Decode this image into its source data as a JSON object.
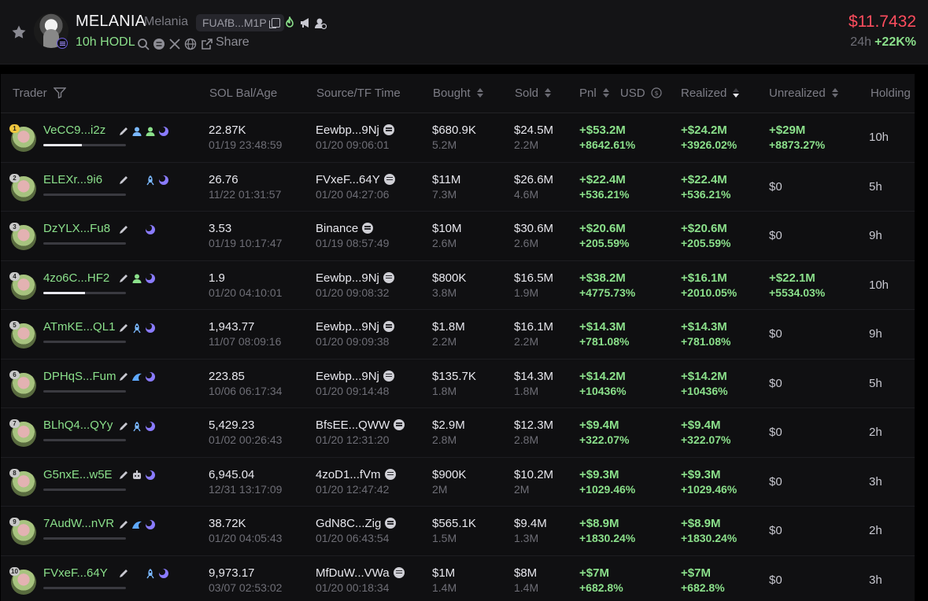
{
  "header": {
    "symbol": "MELANIA",
    "name": "Melania",
    "address": "FUAfB...M1P",
    "hodl": "10h HODL",
    "share": "Share",
    "price": "$11.7432",
    "change_label": "24h",
    "change_value": "+22K%",
    "icons": [
      "star-icon",
      "copy-icon",
      "fire-icon",
      "megaphone-icon",
      "dev-icon",
      "search-icon",
      "chain-icon",
      "x-icon",
      "globe-icon",
      "share-icon"
    ]
  },
  "columns": {
    "trader": "Trader",
    "sol_bal": "SOL Bal/Age",
    "source": "Source/TF Time",
    "bought": "Bought",
    "sold": "Sold",
    "pnl": "Pnl",
    "usd": "USD",
    "realized": "Realized",
    "unrealized": "Unrealized",
    "holding": "Holding"
  },
  "rows": [
    {
      "rank": "1",
      "trader": "VeCC9...i2z",
      "tags": [
        "pencil",
        "user-blue",
        "user-green",
        "moon"
      ],
      "bar": 0.47,
      "sol": "22.87K",
      "age": "01/19 23:48:59",
      "source": "Eewbp...9Nj",
      "tf": "01/20 09:06:01",
      "bought": "$680.9K",
      "bought_amt": "5.2M",
      "sold": "$24.5M",
      "sold_amt": "2.2M",
      "pnl": "+$53.2M",
      "pnl_pct": "+8642.61%",
      "realized": "+$24.2M",
      "realized_pct": "+3926.02%",
      "unrealized": "+$29M",
      "unrealized_pct": "+8873.27%",
      "holding": "10h"
    },
    {
      "rank": "2",
      "trader": "ELEXr...9i6",
      "tags": [
        "pencil",
        "blank",
        "rocket",
        "moon"
      ],
      "bar": 0,
      "sol": "26.76",
      "age": "11/22 01:31:57",
      "source": "FVxeF...64Y",
      "tf": "01/20 04:27:06",
      "bought": "$11M",
      "bought_amt": "7.3M",
      "sold": "$26.6M",
      "sold_amt": "4.6M",
      "pnl": "+$22.4M",
      "pnl_pct": "+536.21%",
      "realized": "+$22.4M",
      "realized_pct": "+536.21%",
      "unrealized": "$0",
      "unrealized_pct": "",
      "holding": "5h"
    },
    {
      "rank": "3",
      "trader": "DzYLX...Fu8",
      "tags": [
        "pencil",
        "blank",
        "moon"
      ],
      "bar": 0,
      "sol": "3.53",
      "age": "01/19 10:17:47",
      "source": "Binance",
      "tf": "01/19 08:57:49",
      "bought": "$10M",
      "bought_amt": "2.6M",
      "sold": "$30.6M",
      "sold_amt": "2.6M",
      "pnl": "+$20.6M",
      "pnl_pct": "+205.59%",
      "realized": "+$20.6M",
      "realized_pct": "+205.59%",
      "unrealized": "$0",
      "unrealized_pct": "",
      "holding": "9h"
    },
    {
      "rank": "4",
      "trader": "4zo6C...HF2",
      "tags": [
        "pencil",
        "user-green",
        "moon"
      ],
      "bar": 0.5,
      "sol": "1.9",
      "age": "01/20 04:10:01",
      "source": "Eewbp...9Nj",
      "tf": "01/20 09:08:32",
      "bought": "$800K",
      "bought_amt": "3.8M",
      "sold": "$16.5M",
      "sold_amt": "1.9M",
      "pnl": "+$38.2M",
      "pnl_pct": "+4775.73%",
      "realized": "+$16.1M",
      "realized_pct": "+2010.05%",
      "unrealized": "+$22.1M",
      "unrealized_pct": "+5534.03%",
      "holding": "10h"
    },
    {
      "rank": "5",
      "trader": "ATmKE...QL1",
      "tags": [
        "pencil",
        "rocket",
        "moon"
      ],
      "bar": 0,
      "sol": "1,943.77",
      "age": "11/07 08:09:16",
      "source": "Eewbp...9Nj",
      "tf": "01/20 09:09:38",
      "bought": "$1.8M",
      "bought_amt": "2.2M",
      "sold": "$16.1M",
      "sold_amt": "2.2M",
      "pnl": "+$14.3M",
      "pnl_pct": "+781.08%",
      "realized": "+$14.3M",
      "realized_pct": "+781.08%",
      "unrealized": "$0",
      "unrealized_pct": "",
      "holding": "9h"
    },
    {
      "rank": "6",
      "trader": "DPHqS...Fum",
      "tags": [
        "pencil",
        "wave",
        "moon"
      ],
      "bar": 0,
      "sol": "223.85",
      "age": "10/06 06:17:34",
      "source": "Eewbp...9Nj",
      "tf": "01/20 09:14:48",
      "bought": "$135.7K",
      "bought_amt": "1.8M",
      "sold": "$14.3M",
      "sold_amt": "1.8M",
      "pnl": "+$14.2M",
      "pnl_pct": "+10436%",
      "realized": "+$14.2M",
      "realized_pct": "+10436%",
      "unrealized": "$0",
      "unrealized_pct": "",
      "holding": "5h"
    },
    {
      "rank": "7",
      "trader": "BLhQ4...QYy",
      "tags": [
        "pencil",
        "rocket",
        "moon"
      ],
      "bar": 0,
      "sol": "5,429.23",
      "age": "01/02 00:26:43",
      "source": "BfsEE...QWW",
      "tf": "01/20 12:31:20",
      "bought": "$2.9M",
      "bought_amt": "2.8M",
      "sold": "$12.3M",
      "sold_amt": "2.8M",
      "pnl": "+$9.4M",
      "pnl_pct": "+322.07%",
      "realized": "+$9.4M",
      "realized_pct": "+322.07%",
      "unrealized": "$0",
      "unrealized_pct": "",
      "holding": "2h"
    },
    {
      "rank": "8",
      "trader": "G5nxE...w5E",
      "tags": [
        "pencil",
        "bot",
        "moon"
      ],
      "bar": 0,
      "sol": "6,945.04",
      "age": "12/31 13:17:09",
      "source": "4zoD1...fVm",
      "tf": "01/20 12:47:42",
      "bought": "$900K",
      "bought_amt": "2M",
      "sold": "$10.2M",
      "sold_amt": "2M",
      "pnl": "+$9.3M",
      "pnl_pct": "+1029.46%",
      "realized": "+$9.3M",
      "realized_pct": "+1029.46%",
      "unrealized": "$0",
      "unrealized_pct": "",
      "holding": "3h"
    },
    {
      "rank": "9",
      "trader": "7AudW...nVR",
      "tags": [
        "pencil",
        "wave",
        "moon"
      ],
      "bar": 0,
      "sol": "38.72K",
      "age": "01/20 04:05:43",
      "source": "GdN8C...Zig",
      "tf": "01/20 06:43:54",
      "bought": "$565.1K",
      "bought_amt": "1.5M",
      "sold": "$9.4M",
      "sold_amt": "1.3M",
      "pnl": "+$8.9M",
      "pnl_pct": "+1830.24%",
      "realized": "+$8.9M",
      "realized_pct": "+1830.24%",
      "unrealized": "$0",
      "unrealized_pct": "",
      "holding": "2h"
    },
    {
      "rank": "10",
      "trader": "FVxeF...64Y",
      "tags": [
        "pencil",
        "blank",
        "rocket",
        "moon"
      ],
      "bar": 0,
      "sol": "9,973.17",
      "age": "03/07 02:53:02",
      "source": "MfDuW...VWa",
      "tf": "01/20 00:18:34",
      "bought": "$1M",
      "bought_amt": "1.4M",
      "sold": "$8M",
      "sold_amt": "1.4M",
      "pnl": "+$7M",
      "pnl_pct": "+682.8%",
      "realized": "+$7M",
      "realized_pct": "+682.8%",
      "unrealized": "$0",
      "unrealized_pct": "",
      "holding": "3h"
    }
  ],
  "colors": {
    "green": "#8be08b",
    "red": "#ff4d5e",
    "purple": "#8a7bff",
    "blue": "#7ab8ff"
  }
}
